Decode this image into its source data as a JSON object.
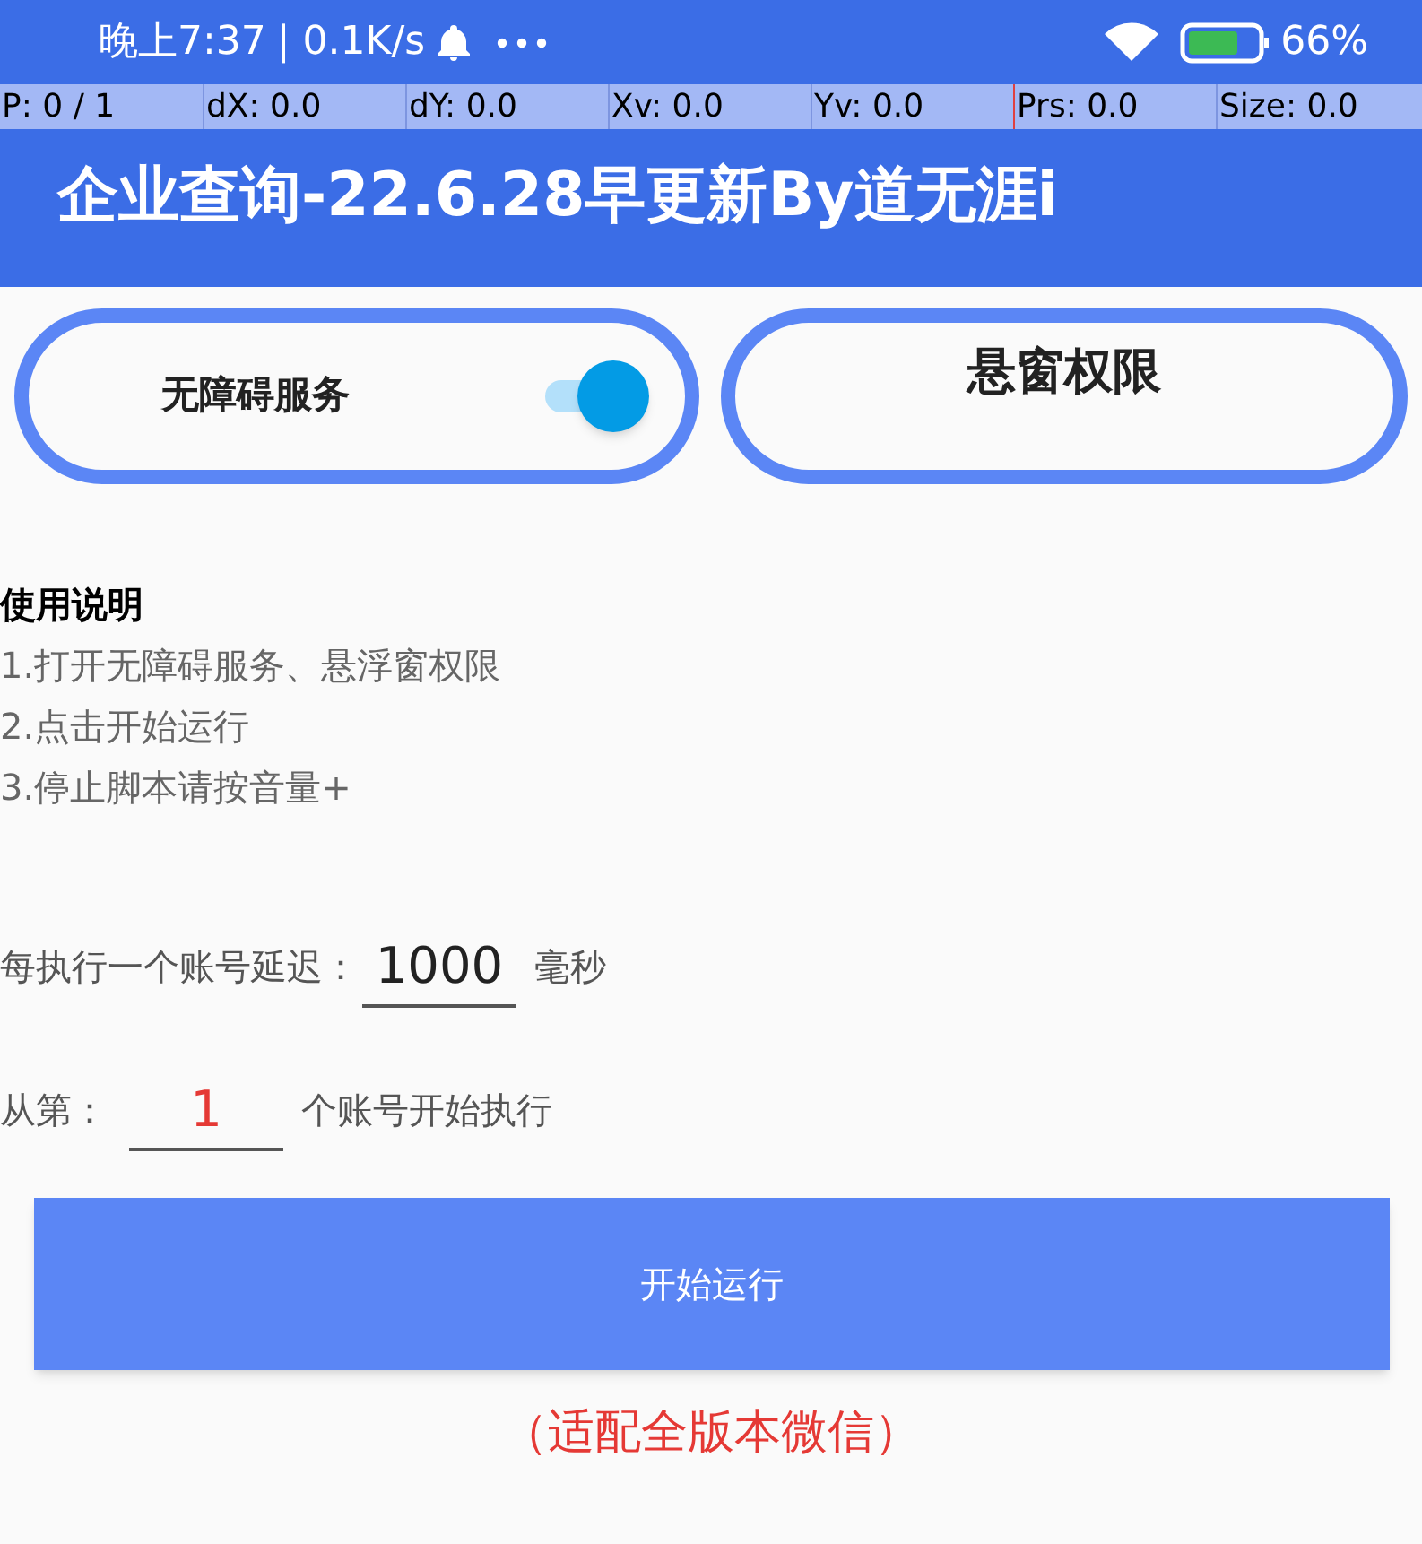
{
  "status_bar": {
    "time": "晚上7:37",
    "speed": "| 0.1K/s",
    "battery": "66%"
  },
  "pointer_bar": [
    "P: 0 / 1",
    "dX: 0.0",
    "dY: 0.0",
    "Xv: 0.0",
    "Yv: 0.0",
    "Prs: 0.0",
    "Size: 0.0"
  ],
  "app_bar": {
    "title": "企业查询-22.6.28早更新By道无涯i"
  },
  "accessibility": {
    "label": "无障碍服务",
    "on": true
  },
  "overlay_button": {
    "label": "悬窗权限"
  },
  "instructions": {
    "heading": "使用说明",
    "lines": [
      "1.打开无障碍服务、悬浮窗权限",
      "2.点击开始运行",
      "3.停止脚本请按音量+"
    ]
  },
  "delay_field": {
    "label": "每执行一个账号延迟：",
    "value": "1000",
    "unit": "毫秒"
  },
  "start_field": {
    "label": "从第：",
    "value": "1",
    "unit": "个账号开始执行"
  },
  "start_button": {
    "label": "开始运行"
  },
  "note": "（适配全版本微信）"
}
